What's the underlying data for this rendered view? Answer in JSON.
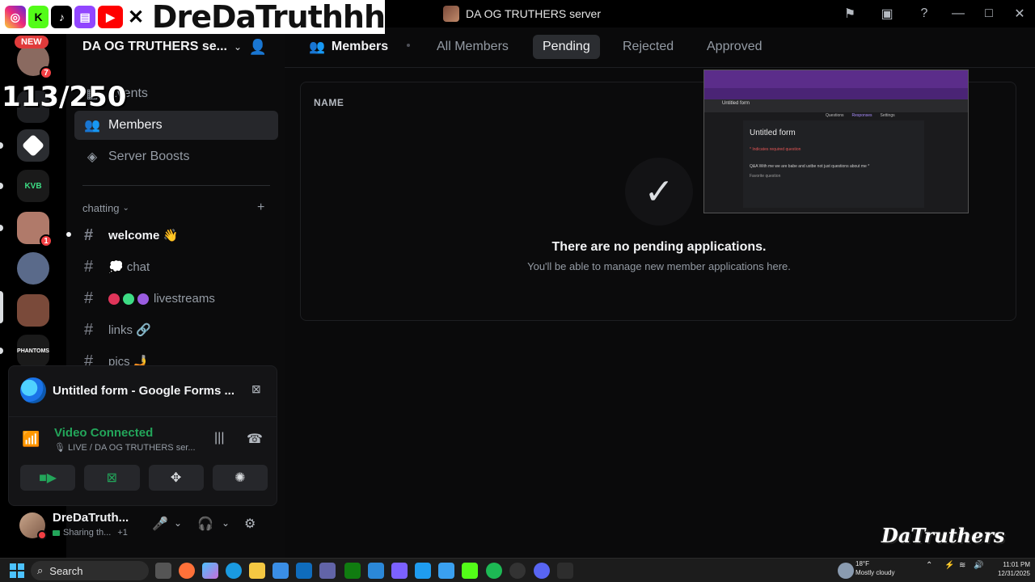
{
  "window": {
    "title": "DA OG TRUTHERS server"
  },
  "overlay": {
    "streamer_name": "DreDaTruthhh",
    "sub_count": "113/250",
    "new_badge": "NEW",
    "social_icons": [
      "instagram-icon",
      "kick-icon",
      "tiktok-icon",
      "twitch-icon",
      "youtube-icon",
      "x-icon"
    ]
  },
  "rail": {
    "badges": [
      "7",
      "1"
    ]
  },
  "sidebar": {
    "server_name": "DA OG TRUTHERS se...",
    "items": [
      {
        "label": "Events",
        "icon": "calendar-icon"
      },
      {
        "label": "Members",
        "icon": "members-icon"
      },
      {
        "label": "Server Boosts",
        "icon": "boost-icon"
      }
    ],
    "category": "chatting",
    "channels": [
      {
        "name": "welcome 👋"
      },
      {
        "name": "💭 chat"
      },
      {
        "name": "livestreams"
      },
      {
        "name": "links 🔗"
      },
      {
        "name": "pics 🤳"
      }
    ]
  },
  "voice": {
    "stream_title": "Untitled form - Google Forms ...",
    "status": "Video Connected",
    "channel": "LIVE / DA OG TRUTHERS ser..."
  },
  "user": {
    "name": "DreDaTruth...",
    "sub": "Sharing th...",
    "extra": "+1"
  },
  "main": {
    "title": "Members",
    "tabs": [
      {
        "label": "All Members"
      },
      {
        "label": "Pending"
      },
      {
        "label": "Rejected"
      },
      {
        "label": "Approved"
      }
    ],
    "column_header": "NAME",
    "empty_title": "There are no pending applications.",
    "empty_subtitle": "You'll be able to manage new member applications here."
  },
  "preview": {
    "doc_name": "Untitled form",
    "form_title": "Untitled form",
    "required_note": "* Indicates required question",
    "question": "Q&A With me we are babe and ustbe not just questions about me *",
    "answer": "Favorite question",
    "tabs": [
      "Questions",
      "Responses",
      "Settings"
    ]
  },
  "watermark": "DaTruthers",
  "taskbar": {
    "search": "Search",
    "weather_temp": "18°F",
    "weather_desc": "Mostly cloudy",
    "time": "11:01 PM",
    "date": "12/31/2025"
  },
  "colors": {
    "accent_green": "#23a55a",
    "danger_red": "#f23f43",
    "active_tab_bg": "#2b2d31"
  }
}
